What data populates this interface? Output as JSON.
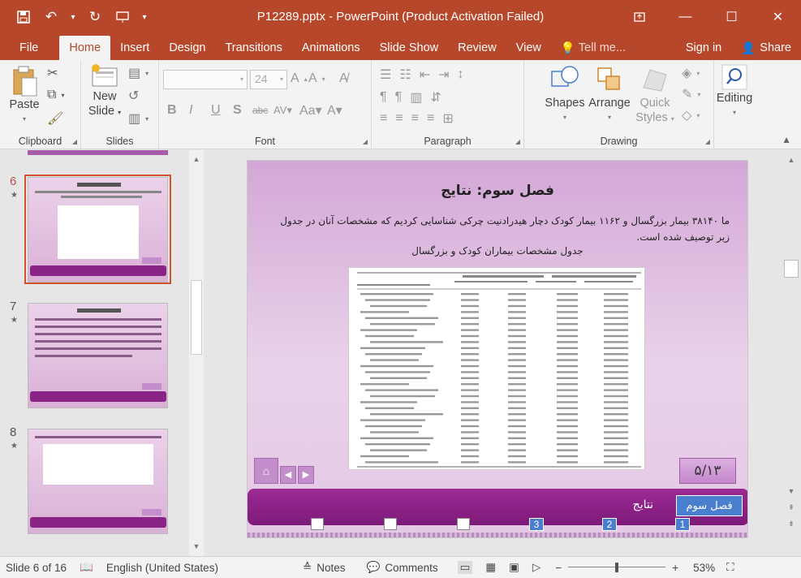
{
  "window": {
    "title": "P12289.pptx - PowerPoint (Product Activation Failed)",
    "accent": "#b7472a"
  },
  "tabs": {
    "file": "File",
    "home": "Home",
    "insert": "Insert",
    "design": "Design",
    "transitions": "Transitions",
    "animations": "Animations",
    "slideshow": "Slide Show",
    "review": "Review",
    "view": "View",
    "tell": "Tell me...",
    "signin": "Sign in",
    "share": "Share"
  },
  "ribbon": {
    "paste": "Paste",
    "new_slide_1": "New",
    "new_slide_2": "Slide",
    "font_size": "24",
    "shapes": "Shapes",
    "arrange": "Arrange",
    "quick_styles_1": "Quick",
    "quick_styles_2": "Styles",
    "editing": "Editing",
    "groups": {
      "clipboard": "Clipboard",
      "slides": "Slides",
      "font": "Font",
      "paragraph": "Paragraph",
      "drawing": "Drawing"
    }
  },
  "thumbnails": [
    {
      "num": "6",
      "selected": true
    },
    {
      "num": "7",
      "selected": false
    },
    {
      "num": "8",
      "selected": false
    }
  ],
  "slide": {
    "title": "فصل سوم: نتایج",
    "body": "ما ۳۸۱۴۰ بیمار بزرگسال و ۱۱۶۲ بیمار کودک دچار هیدرادنیت چرکی شناسایی کردیم که مشخصات آنان در جدول زیر توصیف شده است.",
    "caption": "جدول مشخصات بیماران کودک و بزرگسال",
    "page": "۵/۱۳",
    "chapter": "فصل سوم",
    "section": "نتایج",
    "nav_numbers": [
      "3",
      "2",
      "1"
    ]
  },
  "statusbar": {
    "slide_info": "Slide 6 of 16",
    "language": "English (United States)",
    "notes": "Notes",
    "comments": "Comments",
    "zoom": "53%"
  }
}
